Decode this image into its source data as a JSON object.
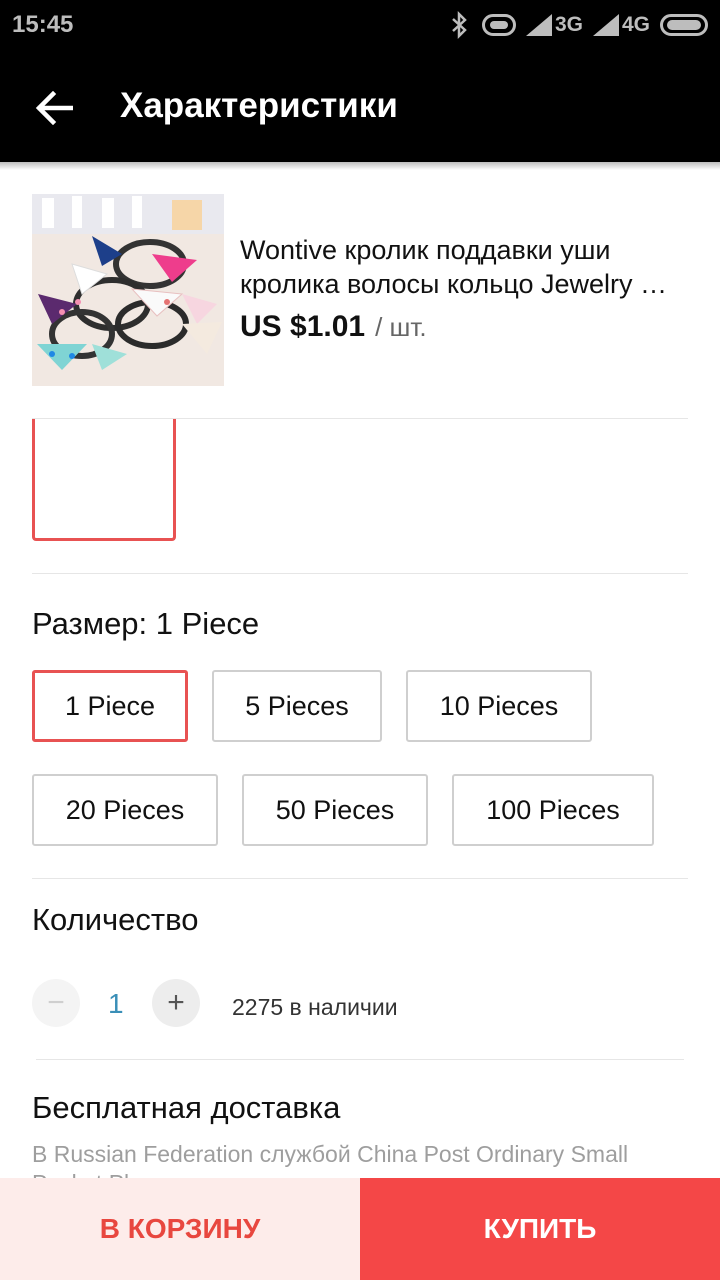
{
  "status_bar": {
    "time": "15:45",
    "network_1": "3G",
    "network_2": "4G",
    "icons": [
      "bluetooth-icon",
      "vibrate-icon",
      "signal-icon",
      "signal-icon",
      "battery-icon"
    ]
  },
  "app_bar": {
    "title": "Характеристики",
    "back_icon": "arrow-left-icon"
  },
  "product": {
    "name_line1": "Wontive кролик поддавки уши",
    "name_line2": "кролика волосы кольцо Jewelry …",
    "price": "US $1.01",
    "unit": "/ шт.",
    "image": "hair-ties-photo"
  },
  "size": {
    "label": "Размер: 1 Piece",
    "selected": "1 Piece",
    "options": [
      "1 Piece",
      "5 Pieces",
      "10 Pieces",
      "20 Pieces",
      "50 Pieces",
      "100 Pieces"
    ]
  },
  "quantity": {
    "label": "Количество",
    "minus": "−",
    "plus": "+",
    "value": "1",
    "stock": "2275 в наличии"
  },
  "shipping": {
    "title": "Бесплатная доставка",
    "description": "В Russian Federation службой China Post Ordinary Small Packet Plus"
  },
  "actions": {
    "cart": "В КОРЗИНУ",
    "buy": "КУПИТЬ"
  },
  "colors": {
    "accent": "#e85252",
    "buy_bg": "#f44747",
    "cart_bg": "#fdecea",
    "qty_value": "#3a8fb7"
  }
}
